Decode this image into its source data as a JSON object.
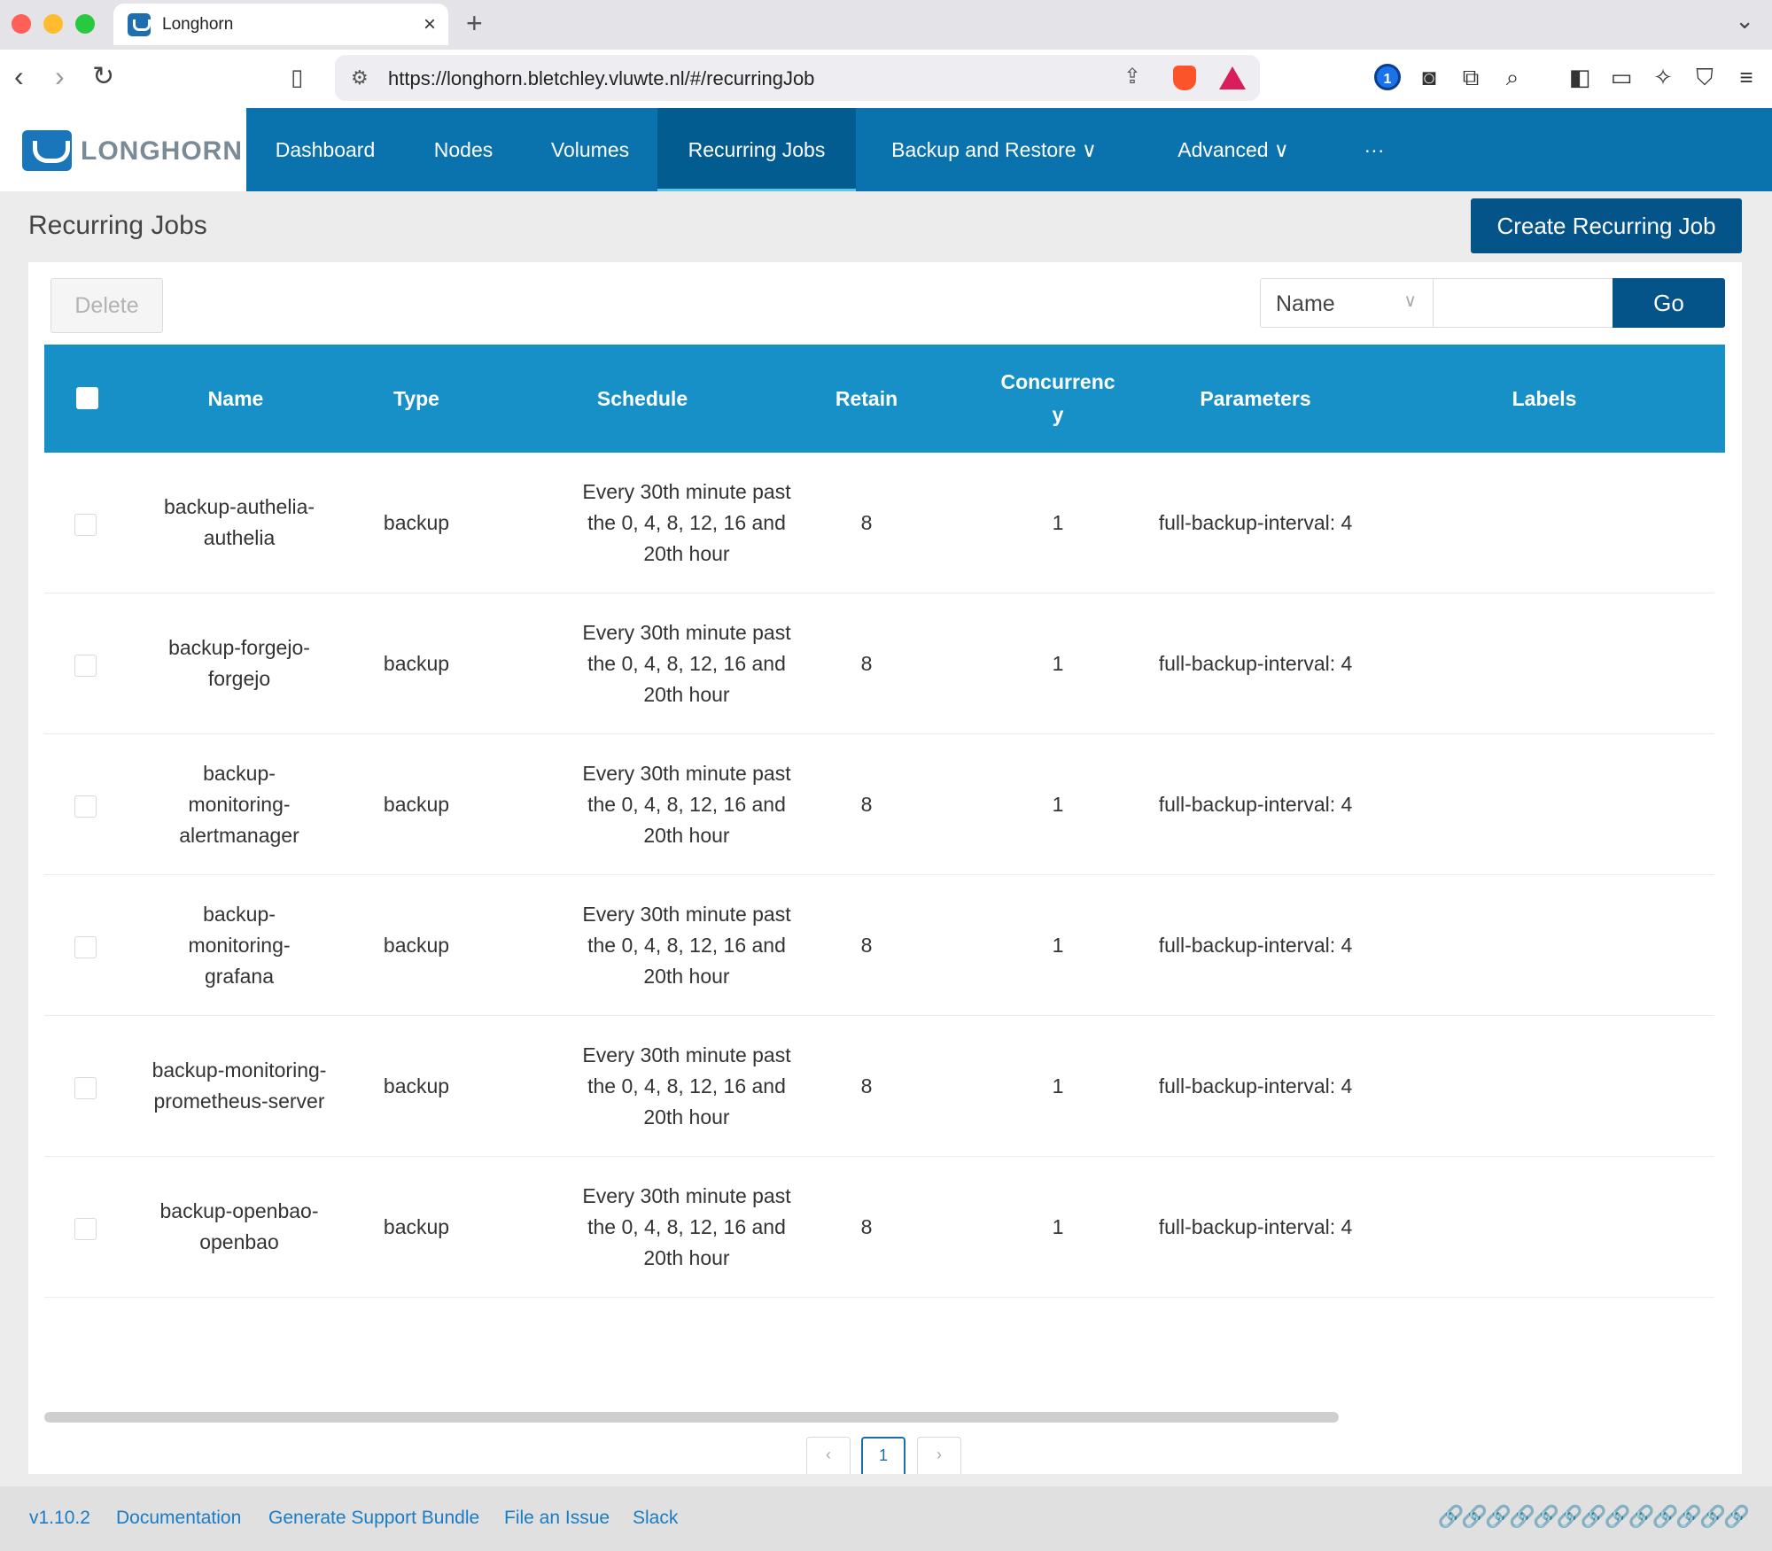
{
  "browser": {
    "tab_title": "Longhorn",
    "tab_close": "×",
    "new_tab": "+",
    "url": "https://longhorn.bletchley.vluwte.nl/#/recurringJob"
  },
  "app": {
    "logo_text": "LONGHORN",
    "nav": [
      {
        "label": "Dashboard"
      },
      {
        "label": "Nodes"
      },
      {
        "label": "Volumes"
      },
      {
        "label": "Recurring Jobs",
        "active": true
      },
      {
        "label": "Backup and Restore ∨"
      },
      {
        "label": "Advanced ∨"
      },
      {
        "label": "···"
      }
    ]
  },
  "page": {
    "title": "Recurring Jobs",
    "create_button": "Create Recurring Job",
    "delete_button": "Delete",
    "filter": {
      "field": "Name",
      "value": "",
      "go_button": "Go"
    }
  },
  "table": {
    "headers": [
      "Name",
      "Type",
      "Schedule",
      "Retain",
      "Concurrenc y",
      "Parameters",
      "Labels"
    ],
    "rows": [
      {
        "name": "backup-authelia-authelia",
        "type": "backup",
        "schedule": "Every 30th minute past the 0, 4, 8, 12, 16 and 20th hour",
        "retain": "8",
        "concurrency": "1",
        "parameters": "full-backup-interval: 4",
        "labels": ""
      },
      {
        "name": "backup-forgejo-forgejo",
        "type": "backup",
        "schedule": "Every 30th minute past the 0, 4, 8, 12, 16 and 20th hour",
        "retain": "8",
        "concurrency": "1",
        "parameters": "full-backup-interval: 4",
        "labels": ""
      },
      {
        "name": "backup-monitoring-alertmanager",
        "type": "backup",
        "schedule": "Every 30th minute past the 0, 4, 8, 12, 16 and 20th hour",
        "retain": "8",
        "concurrency": "1",
        "parameters": "full-backup-interval: 4",
        "labels": ""
      },
      {
        "name": "backup-monitoring-grafana",
        "type": "backup",
        "schedule": "Every 30th minute past the 0, 4, 8, 12, 16 and 20th hour",
        "retain": "8",
        "concurrency": "1",
        "parameters": "full-backup-interval: 4",
        "labels": ""
      },
      {
        "name": "backup-monitoring-prometheus-server",
        "type": "backup",
        "schedule": "Every 30th minute past the 0, 4, 8, 12, 16 and 20th hour",
        "retain": "8",
        "concurrency": "1",
        "parameters": "full-backup-interval: 4",
        "labels": ""
      },
      {
        "name": "backup-openbao-openbao",
        "type": "backup",
        "schedule": "Every 30th minute past the 0, 4, 8, 12, 16 and 20th hour",
        "retain": "8",
        "concurrency": "1",
        "parameters": "full-backup-interval: 4",
        "labels": ""
      }
    ]
  },
  "pagination": {
    "prev": "‹",
    "current": "1",
    "next": "›"
  },
  "footer": {
    "version": "v1.10.2",
    "links": [
      "Documentation",
      "Generate Support Bundle",
      "File an Issue",
      "Slack"
    ]
  },
  "colors": {
    "nav_bg": "#0a72ad",
    "header_bg": "#1690c6",
    "primary_button": "#04548a"
  }
}
